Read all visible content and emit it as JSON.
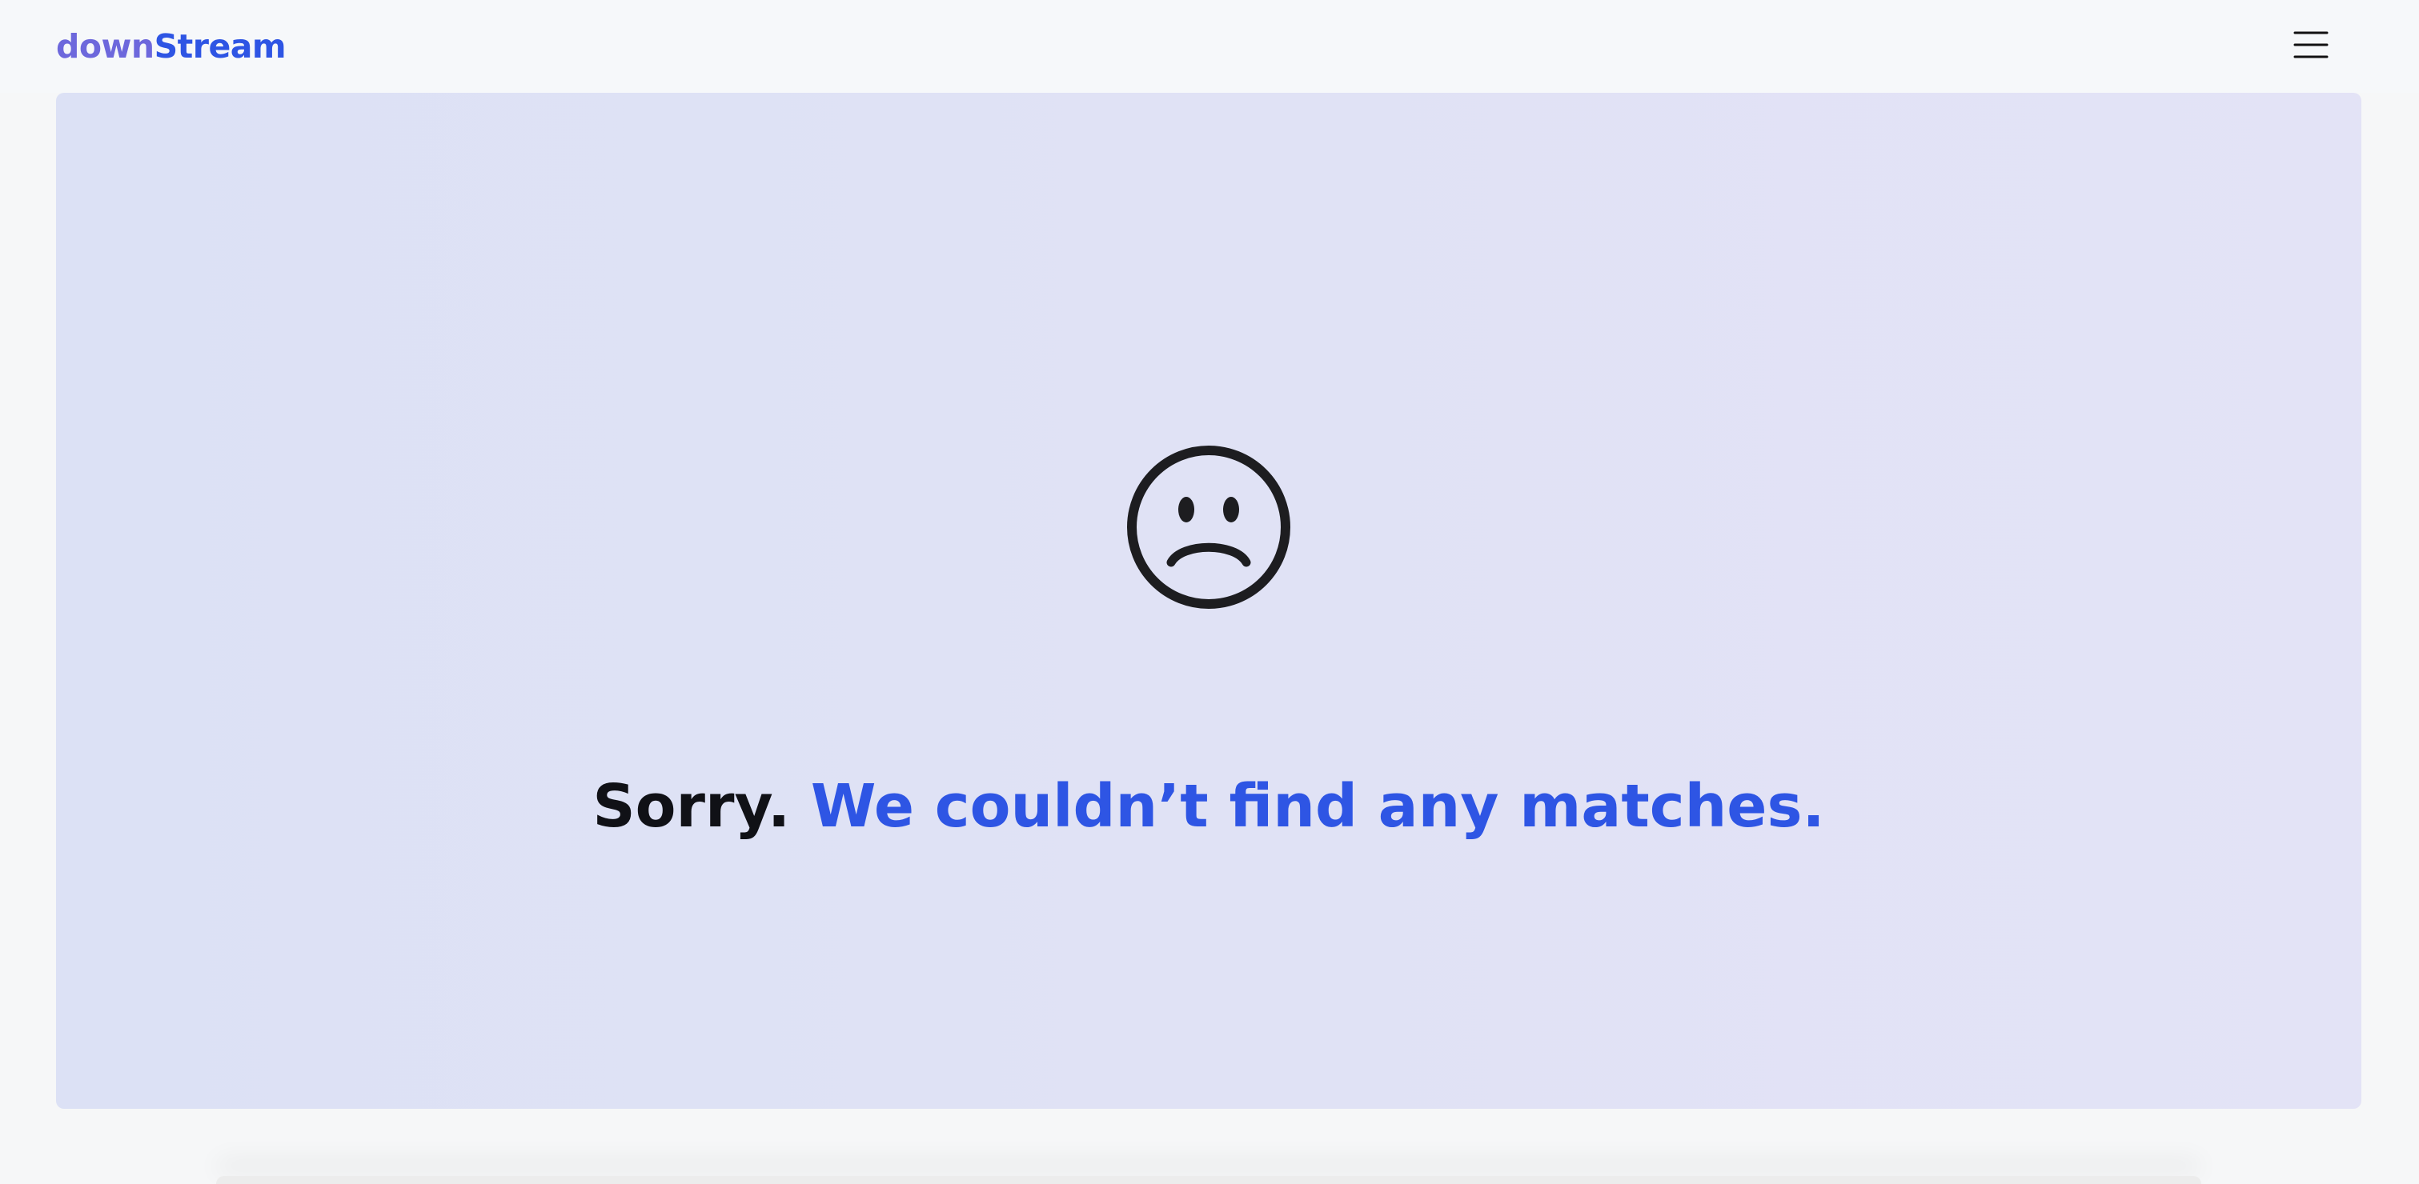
{
  "header": {
    "logo_part1": "down",
    "logo_part2": "Stream",
    "menu_icon": "hamburger-menu-icon"
  },
  "empty_state": {
    "icon": "sad-face-icon",
    "headline_lead": "Sorry.",
    "headline_rest": "We couldn’t find any matches."
  },
  "colors": {
    "brand_blue": "#2e55e4",
    "brand_purple": "#6d68dc",
    "panel_background": "#dfe2f5",
    "text_dark": "#101116"
  }
}
